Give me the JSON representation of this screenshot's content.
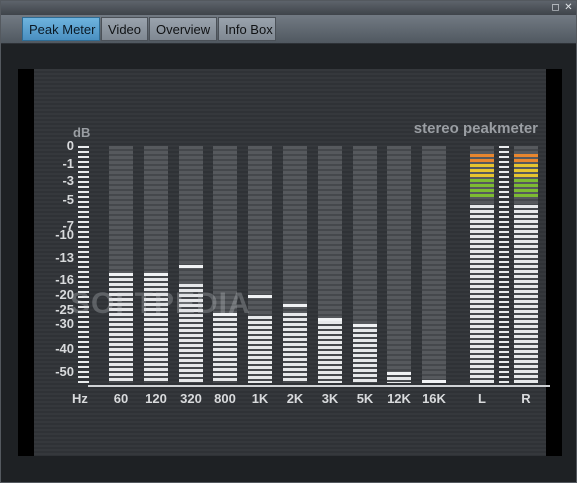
{
  "window": {
    "maximize_glyph": "◻",
    "close_glyph": "✕"
  },
  "tabs": [
    {
      "label": "Peak Meter",
      "active": true
    },
    {
      "label": "Video",
      "active": false
    },
    {
      "label": "Overview",
      "active": false
    },
    {
      "label": "Info Box",
      "active": false
    }
  ],
  "meter": {
    "title": "stereo peakmeter",
    "db_unit": "dB",
    "hz_unit": "Hz",
    "db_ticks": [
      "0",
      "-1",
      "-3",
      "-5",
      "-7",
      "-10",
      "-13",
      "-16",
      "-20",
      "-25",
      "-30",
      "-40",
      "-50"
    ],
    "bands": [
      {
        "label": "60",
        "level_db": -15,
        "peak_db": -15
      },
      {
        "label": "120",
        "level_db": -15,
        "peak_db": -15
      },
      {
        "label": "320",
        "level_db": -17,
        "peak_db": -14
      },
      {
        "label": "800",
        "level_db": -26,
        "peak_db": -26
      },
      {
        "label": "1K",
        "level_db": -27,
        "peak_db": -20
      },
      {
        "label": "2K",
        "level_db": -26,
        "peak_db": -23
      },
      {
        "label": "3K",
        "level_db": -29,
        "peak_db": -28
      },
      {
        "label": "5K",
        "level_db": -32,
        "peak_db": -30
      },
      {
        "label": "12K",
        "level_db": -50,
        "peak_db": -50
      },
      {
        "label": "16K",
        "level_db": -60,
        "peak_db": -60
      }
    ],
    "stereo": [
      {
        "label": "L",
        "level_db": 0,
        "peak_db": 0
      },
      {
        "label": "R",
        "level_db": 0,
        "peak_db": 0
      }
    ],
    "segment_colors": {
      "orange": "#e8862e",
      "yellow": "#e6c52e",
      "green": "#7dbb32"
    },
    "watermark": "SOFTPEDIA"
  }
}
